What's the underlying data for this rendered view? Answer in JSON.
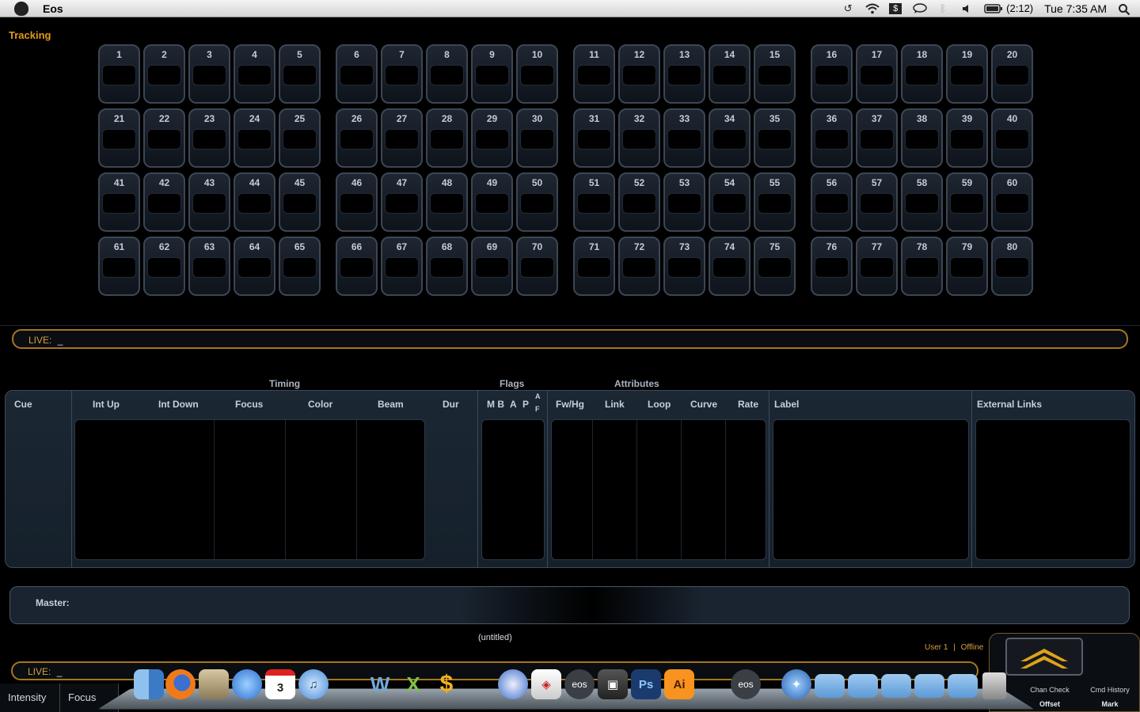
{
  "menubar": {
    "app_name": "Eos",
    "battery_time": "(2:12)",
    "clock": "Tue 7:35 AM",
    "status_icons": [
      "time-machine-icon",
      "wifi-icon",
      "dropbox-icon",
      "chat-icon",
      "bluetooth-icon",
      "volume-icon",
      "battery-icon",
      "spotlight-icon"
    ]
  },
  "tracking": {
    "title": "Tracking",
    "channel_count": 80
  },
  "live_top": {
    "label": "LIVE:",
    "value": "_"
  },
  "cue_list": {
    "group_headers": {
      "timing": "Timing",
      "flags": "Flags",
      "attributes": "Attributes"
    },
    "columns": {
      "cue": "Cue",
      "int_up": "Int Up",
      "int_down": "Int Down",
      "focus": "Focus",
      "color": "Color",
      "beam": "Beam",
      "dur": "Dur",
      "flags_mb": "M B",
      "flags_a": "A",
      "flags_p": "P",
      "flags_af_top": "A",
      "flags_af_bottom": "F",
      "fwhg": "Fw/Hg",
      "link": "Link",
      "loop": "Loop",
      "curve": "Curve",
      "rate": "Rate",
      "label": "Label",
      "external_links": "External Links"
    }
  },
  "master": {
    "label": "Master:"
  },
  "show_file": "(untitled)",
  "status": {
    "user": "User 1",
    "separator": "|",
    "mode": "Offline"
  },
  "live_bottom": {
    "label": "LIVE:",
    "value": "_"
  },
  "tabs": [
    "Intensity",
    "Focus"
  ],
  "softkeys": [
    {
      "label": "Chan Check",
      "sub": "Offset"
    },
    {
      "label": "Cmd History",
      "sub": "Mark"
    }
  ],
  "dock": {
    "icons": [
      "finder-icon",
      "firefox-icon",
      "mail-icon",
      "ichat-icon",
      "ical-icon",
      "itunes-icon",
      "word-icon",
      "excel-icon",
      "dollar-icon",
      "safari-icon",
      "preview-icon",
      "eos-icon",
      "iphoto-icon",
      "photoshop-icon",
      "illustrator-icon",
      "eos-icon",
      "network-icon",
      "folder-icon",
      "folder-icon",
      "folder-icon",
      "folder-icon",
      "folder-icon",
      "trash-icon"
    ],
    "ical_day": "3",
    "ps_label": "Ps",
    "ai_label": "Ai",
    "eos_label": "eos"
  }
}
